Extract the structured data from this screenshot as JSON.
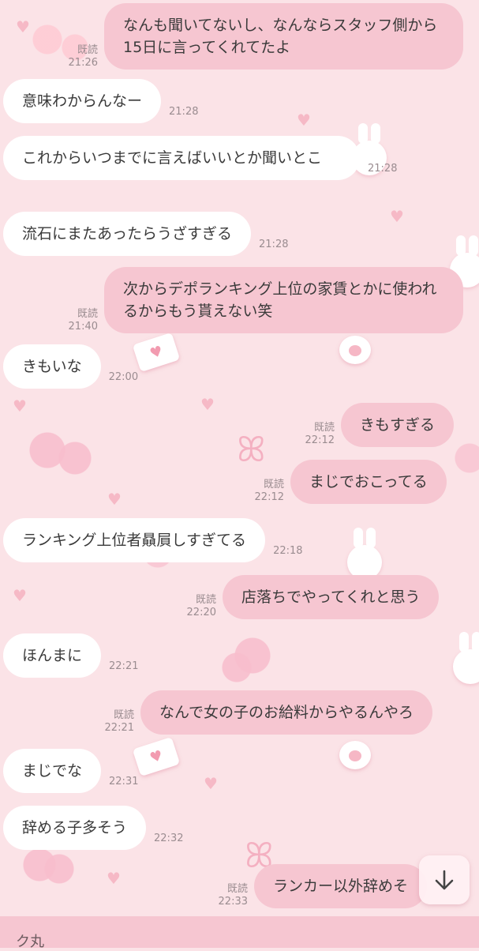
{
  "read_label": "既読",
  "messages": [
    {
      "side": "out",
      "text": "なんも聞いてないし、なんならスタッフ側から15日に言ってくれてたよ",
      "time": "21:26",
      "read": true
    },
    {
      "side": "in",
      "text": "意味わからんなー",
      "time": "21:28"
    },
    {
      "side": "in",
      "text": "これからいつまでに言えばいいとか聞いとこ",
      "time": "21:28"
    },
    {
      "side": "in",
      "text": "流石にまたあったらうざすぎる",
      "time": "21:28"
    },
    {
      "side": "out",
      "text": "次からデポランキング上位の家賃とかに使われるからもう貰えない笑",
      "time": "21:40",
      "read": true
    },
    {
      "side": "in",
      "text": "きもいな",
      "time": "22:00"
    },
    {
      "side": "out",
      "text": "きもすぎる",
      "time": "22:12",
      "read": true
    },
    {
      "side": "out",
      "text": "まじでおこってる",
      "time": "22:12",
      "read": true
    },
    {
      "side": "in",
      "text": "ランキング上位者贔屓しすぎてる",
      "time": "22:18"
    },
    {
      "side": "out",
      "text": "店落ちでやってくれと思う",
      "time": "22:20",
      "read": true
    },
    {
      "side": "in",
      "text": "ほんまに",
      "time": "22:21"
    },
    {
      "side": "out",
      "text": "なんで女の子のお給料からやるんやろ",
      "time": "22:21",
      "read": true
    },
    {
      "side": "in",
      "text": "まじでな",
      "time": "22:31"
    },
    {
      "side": "in",
      "text": "辞める子多そう",
      "time": "22:32"
    },
    {
      "side": "out",
      "text": "ランカー以外辞めそ",
      "time": "22:33",
      "read": true
    }
  ],
  "input_text": "ク丸",
  "scroll_icon": "arrow-down-icon",
  "colors": {
    "background": "#fbe3e7",
    "incoming": "#ffffff",
    "outgoing": "#f6c6d1",
    "meta": "#9a8c90"
  }
}
